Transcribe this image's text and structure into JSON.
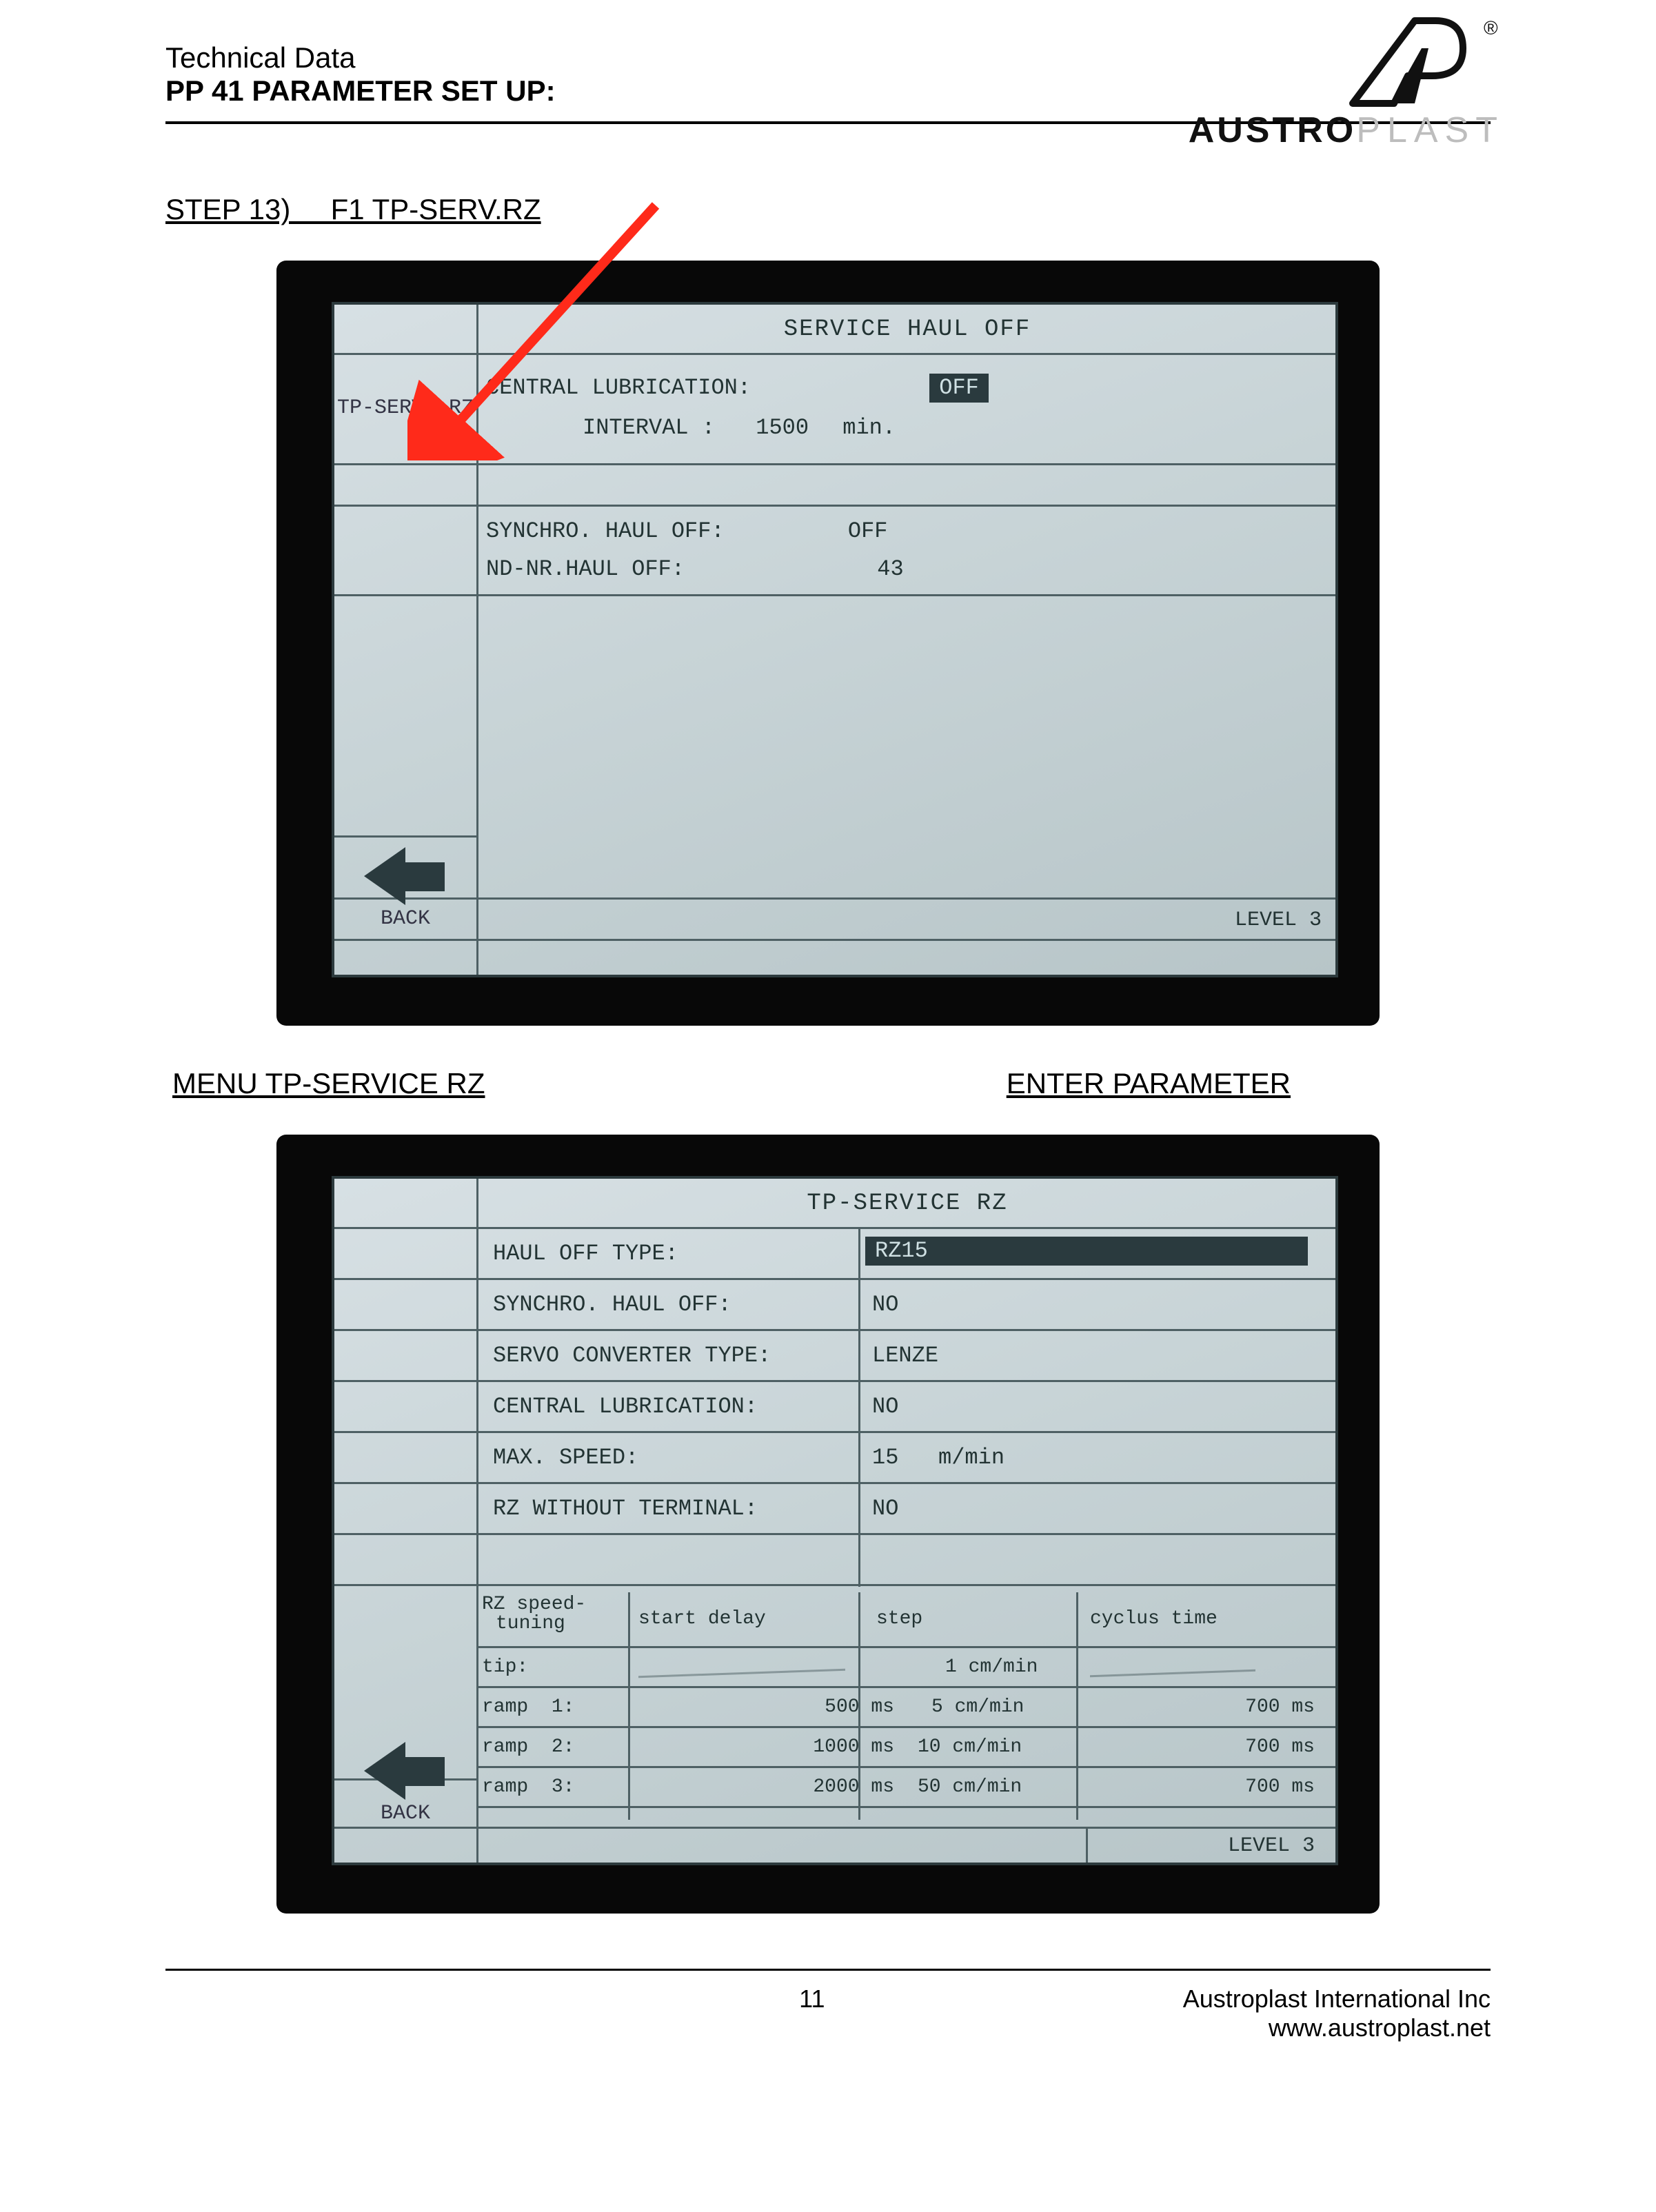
{
  "header": {
    "tech_data": "Technical Data",
    "title": "PP 41 PARAMETER SET UP:",
    "brand_a": "AUSTRO",
    "brand_b": "PLAST",
    "reg": "®"
  },
  "step_heading": "STEP 13)     F1 TP-SERV.RZ",
  "screen1": {
    "side_tab": "TP-SERV. RZ",
    "title": "SERVICE HAUL OFF",
    "central_lub_label": "CENTRAL LUBRICATION:",
    "central_lub_value": "OFF",
    "interval_label": "INTERVAL :",
    "interval_value": "1500",
    "interval_unit": "min.",
    "synchro_label": "SYNCHRO. HAUL OFF:",
    "synchro_value": "OFF",
    "ndnr_label": "ND-NR.HAUL OFF:",
    "ndnr_value": "43",
    "back": "BACK",
    "level": "LEVEL 3"
  },
  "mid_labels": {
    "left": "MENU TP-SERVICE RZ",
    "right": "ENTER PARAMETER"
  },
  "screen2": {
    "title": "TP-SERVICE RZ",
    "rows": [
      {
        "label": "HAUL OFF TYPE:",
        "value": "RZ15",
        "inverse": true
      },
      {
        "label": "SYNCHRO. HAUL OFF:",
        "value": "NO"
      },
      {
        "label": "SERVO CONVERTER TYPE:",
        "value": "LENZE"
      },
      {
        "label": "CENTRAL LUBRICATION:",
        "value": "NO"
      },
      {
        "label": "MAX. SPEED:",
        "value": "15   m/min"
      },
      {
        "label": "RZ WITHOUT TERMINAL:",
        "value": "NO"
      }
    ],
    "st_header": {
      "c0a": "RZ speed-",
      "c0b": "tuning",
      "c1": "start delay",
      "c2": "step",
      "c3": "cyclus time"
    },
    "st_rows": [
      {
        "name": "tip:",
        "delay": "",
        "step": "1 cm/min",
        "cyc": ""
      },
      {
        "name": "ramp  1:",
        "delay": "500 ms",
        "step": "5 cm/min",
        "cyc": "700 ms"
      },
      {
        "name": "ramp  2:",
        "delay": "1000 ms",
        "step": "10 cm/min",
        "cyc": "700 ms"
      },
      {
        "name": "ramp  3:",
        "delay": "2000 ms",
        "step": "50 cm/min",
        "cyc": "700 ms"
      }
    ],
    "back": "BACK",
    "level": "LEVEL 3"
  },
  "footer": {
    "page_no": "11",
    "company": "Austroplast International Inc",
    "url": "www.austroplast.net"
  }
}
